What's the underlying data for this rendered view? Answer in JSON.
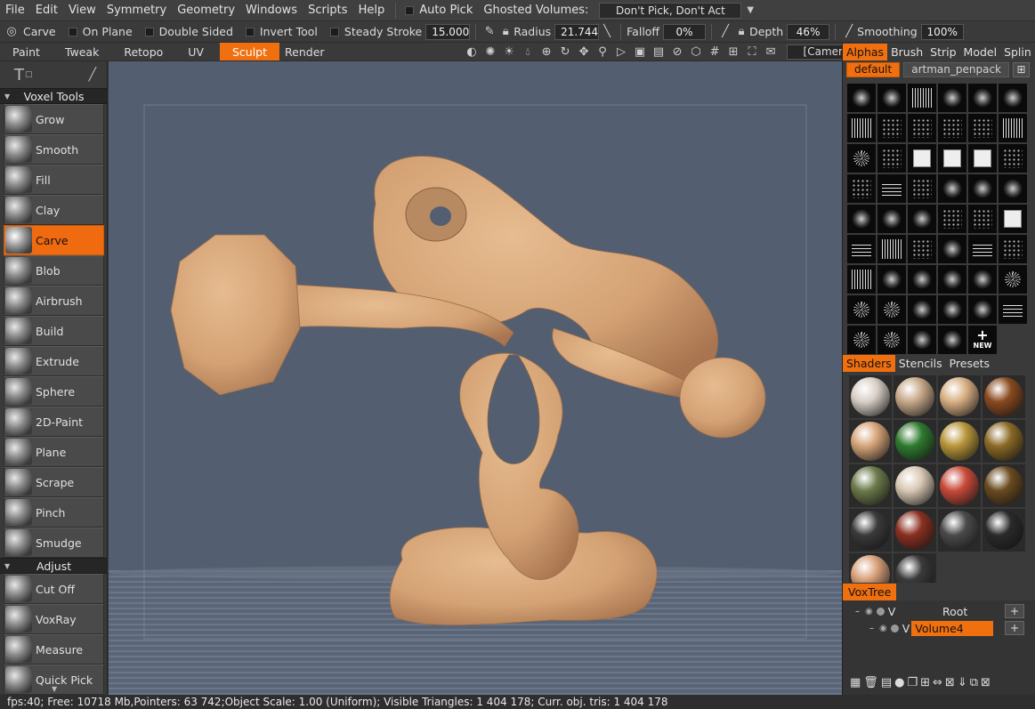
{
  "menubar": {
    "items": [
      "File",
      "Edit",
      "View",
      "Symmetry",
      "Geometry",
      "Windows",
      "Scripts",
      "Help"
    ],
    "auto_pick": "Auto Pick",
    "ghosted_label": "Ghosted Volumes:",
    "ghosted_value": "Don't Pick, Don't Act"
  },
  "tool_options": {
    "current_tool": "Carve",
    "on_plane": "On Plane",
    "double_sided": "Double Sided",
    "invert_tool": "Invert Tool",
    "steady_stroke": "Steady Stroke",
    "steady_value": "15.000",
    "radius_label": "Radius",
    "radius_value": "21.744",
    "falloff_label": "Falloff",
    "falloff_value": "0%",
    "depth_label": "Depth",
    "depth_value": "46%",
    "smoothing_label": "Smoothing",
    "smoothing_value": "100%"
  },
  "rooms": {
    "tabs": [
      "Paint",
      "Tweak",
      "Retopo",
      "UV",
      "Sculpt",
      "Render"
    ],
    "active": "Sculpt",
    "camera": "[Camera]"
  },
  "left_panel": {
    "voxel_tools_title": "Voxel Tools",
    "voxel_tools": [
      "Grow",
      "Smooth",
      "Fill",
      "Clay",
      "Carve",
      "Blob",
      "Airbrush",
      "Build",
      "Extrude",
      "Sphere",
      "2D-Paint",
      "Plane",
      "Scrape",
      "Pinch",
      "Smudge"
    ],
    "active_tool": "Carve",
    "adjust_title": "Adjust",
    "adjust_tools": [
      "Cut Off",
      "VoxRay",
      "Measure",
      "Quick Pick"
    ]
  },
  "alphas": {
    "tabs": [
      "Alphas",
      "Brush",
      "Strip",
      "Model",
      "Splin"
    ],
    "active_tab": "Alphas",
    "sets": [
      "default",
      "artman_penpack"
    ],
    "active_set": "default",
    "new_label": "NEW"
  },
  "shaders": {
    "tabs": [
      "Shaders",
      "Stencils",
      "Presets"
    ],
    "active_tab": "Shaders",
    "balls": [
      "#d8cfc6",
      "#c7a98a",
      "#d8b084",
      "#8a4a20",
      "#d6a479",
      "#2f7a2f",
      "#b8953a",
      "#8b6a25",
      "#6b7a4a",
      "#d8c8b4",
      "#c84a3a",
      "#6a4a20",
      "#3a3a3a",
      "#8a3020",
      "#4a4a4a",
      "#2a2a2a",
      "#d8a07a",
      "#3a3a3a"
    ]
  },
  "voxtree": {
    "tab": "VoxTree",
    "root": "Root",
    "volume": "Volume4",
    "visibility_letter": "V"
  },
  "status": {
    "text": "fps:40;     Free: 10718 Mb,Pointers: 63 742;Object Scale: 1.00 (Uniform); Visible Triangles: 1 404 178; Curr. obj. tris: 1 404 178"
  },
  "colors": {
    "accent": "#f07010",
    "viewport_bg": "#535f71",
    "clay": "#d6a679"
  }
}
